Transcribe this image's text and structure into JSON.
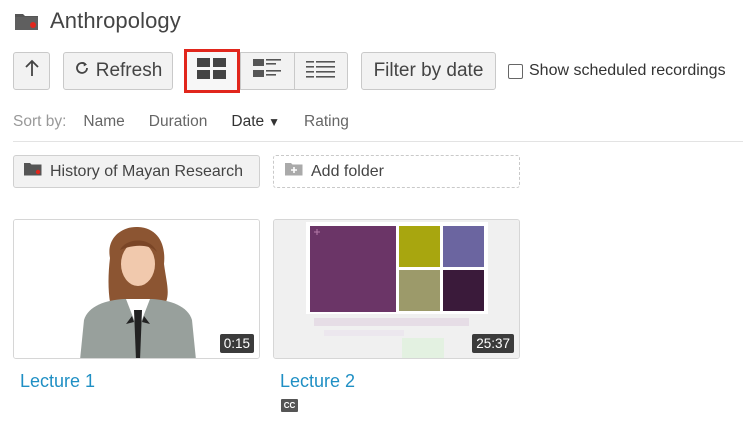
{
  "folder": {
    "title": "Anthropology",
    "icon": "folder-icon"
  },
  "toolbar": {
    "up_icon": "arrow-up-icon",
    "refresh_label": "Refresh",
    "refresh_icon": "refresh-icon",
    "views": [
      "grid-view-icon",
      "detail-view-icon",
      "list-view-icon"
    ],
    "filter_label": "Filter by date",
    "scheduled_label": "Show scheduled recordings",
    "scheduled_checked": false
  },
  "sort": {
    "label": "Sort by:",
    "options": [
      "Name",
      "Duration",
      "Date",
      "Rating"
    ],
    "active": "Date",
    "direction_icon": "caret-down-icon"
  },
  "folders": {
    "subfolder": "History of Mayan Research",
    "add_label": "Add folder"
  },
  "sessions": [
    {
      "title": "Lecture 1",
      "duration": "0:15",
      "captions": false
    },
    {
      "title": "Lecture 2",
      "duration": "25:37",
      "captions": true,
      "captions_label": "CC"
    }
  ],
  "colors": {
    "accent_link": "#1f8fc4",
    "selected_outline": "#e1261c",
    "folder_icon": "#555555",
    "folder_badge": "#e1261c"
  }
}
